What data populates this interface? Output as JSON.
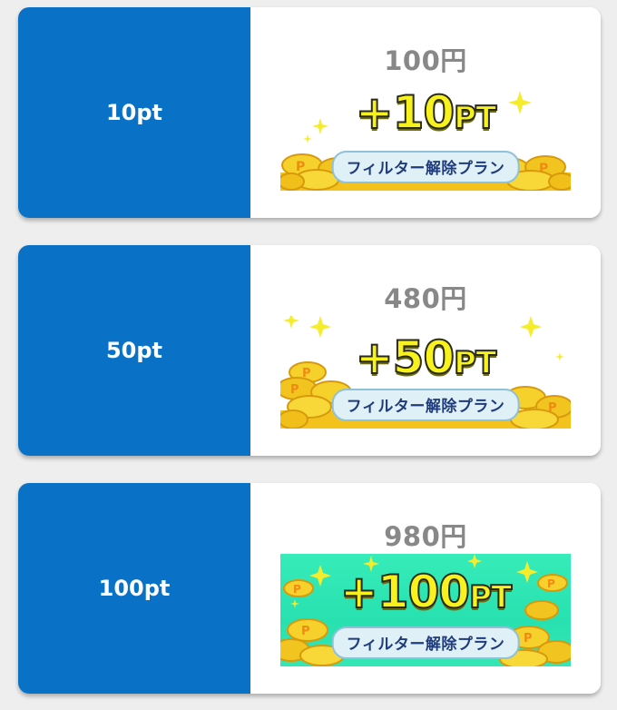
{
  "plans": [
    {
      "points_label": "10pt",
      "price": "100円",
      "banner": {
        "bonus_number": "+10",
        "bonus_unit": "PT",
        "plan_name": "フィルター解除プラン"
      }
    },
    {
      "points_label": "50pt",
      "price": "480円",
      "banner": {
        "bonus_number": "+50",
        "bonus_unit": "PT",
        "plan_name": "フィルター解除プラン"
      }
    },
    {
      "points_label": "100pt",
      "price": "980円",
      "banner": {
        "bonus_number": "+100",
        "bonus_unit": "PT",
        "plan_name": "フィルター解除プラン"
      }
    }
  ],
  "colors": {
    "points_panel": "#0a72c6",
    "price_text": "#888888",
    "bonus_text": "#f7f21d",
    "banner3_background": "#2fe5b4"
  },
  "icons": [
    "sparkle-icon",
    "gold-coin-icon"
  ]
}
